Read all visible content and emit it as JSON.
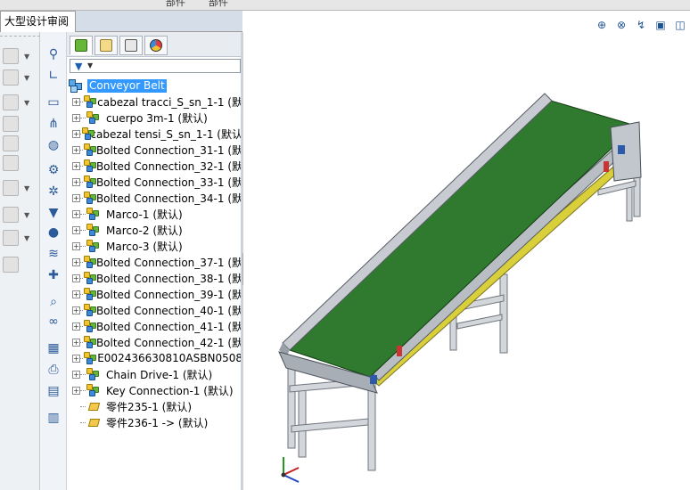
{
  "topbar": {
    "fragments": [
      "部件",
      "部件"
    ]
  },
  "review_tab": {
    "label": "大型设计审阅"
  },
  "feature_tree": {
    "root": "Conveyor Belt",
    "items": [
      {
        "label": "cabezal tracci_S_sn_1-1 (默",
        "kind": "assembly"
      },
      {
        "label": "cuerpo 3m-1 (默认)",
        "kind": "assembly"
      },
      {
        "label": "cabezal tensi_S_sn_1-1 (默认",
        "kind": "assembly"
      },
      {
        "label": "Bolted Connection_31-1 (默",
        "kind": "assembly"
      },
      {
        "label": "Bolted Connection_32-1 (默",
        "kind": "assembly"
      },
      {
        "label": "Bolted Connection_33-1 (默",
        "kind": "assembly"
      },
      {
        "label": "Bolted Connection_34-1 (默",
        "kind": "assembly"
      },
      {
        "label": "Marco-1 (默认)",
        "kind": "assembly"
      },
      {
        "label": "Marco-2 (默认)",
        "kind": "assembly"
      },
      {
        "label": "Marco-3 (默认)",
        "kind": "assembly"
      },
      {
        "label": "Bolted Connection_37-1 (默",
        "kind": "assembly"
      },
      {
        "label": "Bolted Connection_38-1 (默",
        "kind": "assembly"
      },
      {
        "label": "Bolted Connection_39-1 (默",
        "kind": "assembly"
      },
      {
        "label": "Bolted Connection_40-1 (默",
        "kind": "assembly"
      },
      {
        "label": "Bolted Connection_41-1 (默",
        "kind": "assembly"
      },
      {
        "label": "Bolted Connection_42-1 (默",
        "kind": "assembly"
      },
      {
        "label": "E002436630810ASBN0508",
        "kind": "assembly"
      },
      {
        "label": "Chain Drive-1 (默认)",
        "kind": "assembly"
      },
      {
        "label": "Key Connection-1 (默认)",
        "kind": "assembly"
      },
      {
        "label": "零件235-1 (默认)",
        "kind": "part"
      },
      {
        "label": "零件236-1 ->  (默认)",
        "kind": "part"
      }
    ]
  },
  "colors": {
    "belt": "#2f7a2f",
    "frame": "#c8ccd2",
    "side_rail": "#d8cf3a",
    "selection": "#3399ff"
  }
}
